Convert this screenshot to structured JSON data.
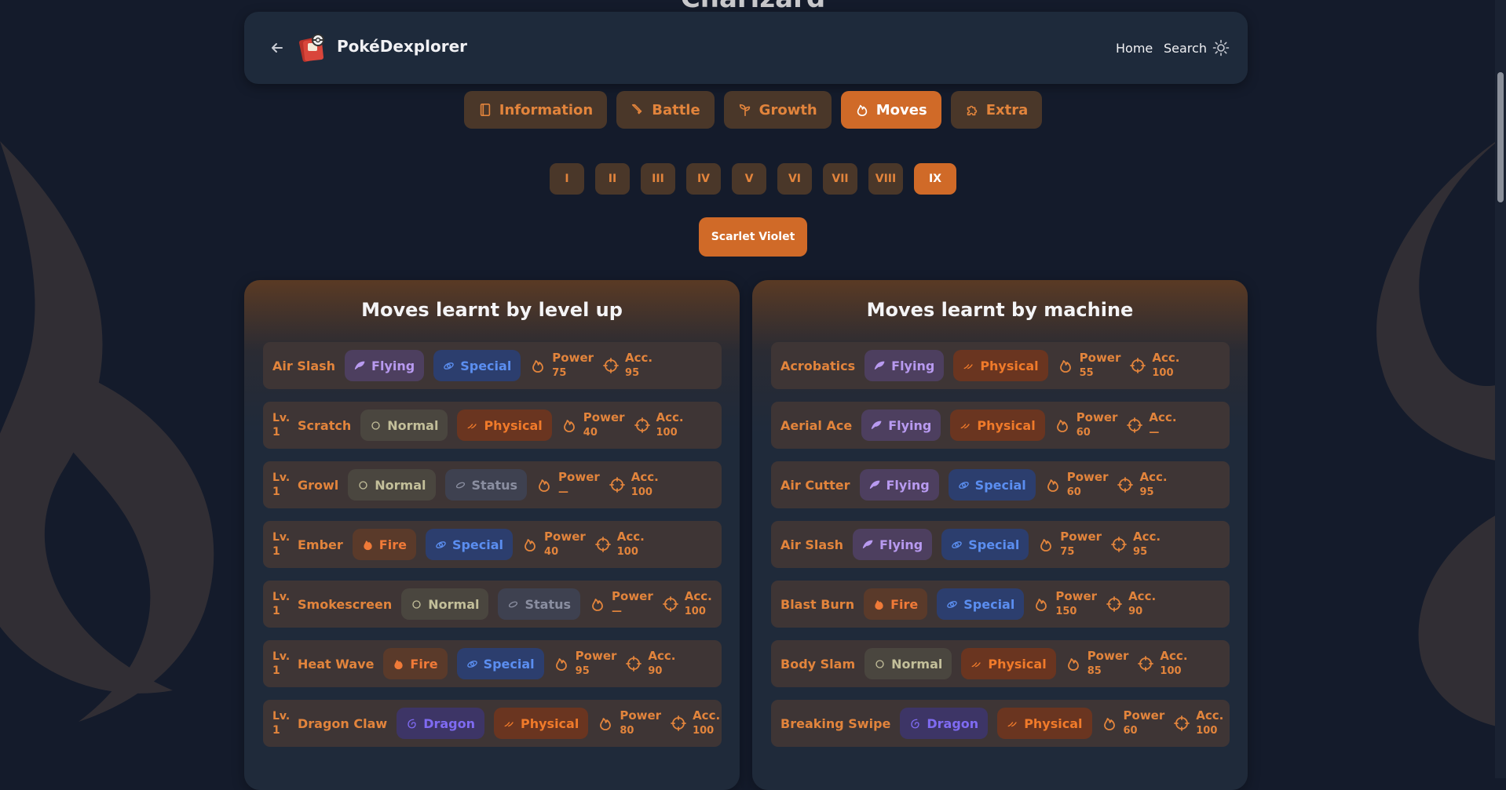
{
  "page": {
    "title_peek": "Charizard"
  },
  "header": {
    "brand": "PokéDexplorer",
    "nav": {
      "home": "Home",
      "search": "Search"
    },
    "icons": {
      "back": "arrow-left-icon",
      "logo": "pokedex-logo",
      "theme": "sun-icon"
    }
  },
  "tabs": [
    {
      "label": "Information",
      "icon": "book-icon",
      "active": false
    },
    {
      "label": "Battle",
      "icon": "sword-icon",
      "active": false
    },
    {
      "label": "Growth",
      "icon": "sprout-icon",
      "active": false
    },
    {
      "label": "Moves",
      "icon": "flame-icon",
      "active": true
    },
    {
      "label": "Extra",
      "icon": "puzzle-icon",
      "active": false
    }
  ],
  "generations": [
    {
      "label": "I",
      "active": false
    },
    {
      "label": "II",
      "active": false
    },
    {
      "label": "III",
      "active": false
    },
    {
      "label": "IV",
      "active": false
    },
    {
      "label": "V",
      "active": false
    },
    {
      "label": "VI",
      "active": false
    },
    {
      "label": "VII",
      "active": false
    },
    {
      "label": "VIII",
      "active": false
    },
    {
      "label": "IX",
      "active": true
    }
  ],
  "version": {
    "label": "Scarlet Violet"
  },
  "labels": {
    "lv": "Lv.",
    "power": "Power",
    "acc": "Acc."
  },
  "colors": {
    "accent": "#d06a28",
    "types": {
      "Flying": {
        "bg": "#4d3f5f",
        "fg": "#b89af0"
      },
      "Normal": {
        "bg": "#4a463f",
        "fg": "#c3bf9a"
      },
      "Fire": {
        "bg": "#5a3a2a",
        "fg": "#f07a38"
      },
      "Dragon": {
        "bg": "#3d3566",
        "fg": "#7f6bf2"
      },
      "Fighting": {
        "bg": "#5a2e2e",
        "fg": "#e05a4a"
      }
    },
    "categories": {
      "Special": {
        "bg": "#2c3e6e",
        "fg": "#5b8ef0"
      },
      "Physical": {
        "bg": "#6a3520",
        "fg": "#f07a2a"
      },
      "Status": {
        "bg": "#3e4150",
        "fg": "#8a8ea0"
      }
    }
  },
  "level_up": {
    "title": "Moves learnt by level up",
    "moves": [
      {
        "level": "",
        "name": "Air Slash",
        "type": "Flying",
        "category": "Special",
        "power": "75",
        "acc": "95"
      },
      {
        "level": "1",
        "name": "Scratch",
        "type": "Normal",
        "category": "Physical",
        "power": "40",
        "acc": "100"
      },
      {
        "level": "1",
        "name": "Growl",
        "type": "Normal",
        "category": "Status",
        "power": "—",
        "acc": "100"
      },
      {
        "level": "1",
        "name": "Ember",
        "type": "Fire",
        "category": "Special",
        "power": "40",
        "acc": "100"
      },
      {
        "level": "1",
        "name": "Smokescreen",
        "type": "Normal",
        "category": "Status",
        "power": "—",
        "acc": "100"
      },
      {
        "level": "1",
        "name": "Heat Wave",
        "type": "Fire",
        "category": "Special",
        "power": "95",
        "acc": "90"
      },
      {
        "level": "1",
        "name": "Dragon Claw",
        "type": "Dragon",
        "category": "Physical",
        "power": "80",
        "acc": "100"
      }
    ]
  },
  "machine": {
    "title": "Moves learnt by machine",
    "moves": [
      {
        "name": "Acrobatics",
        "type": "Flying",
        "category": "Physical",
        "power": "55",
        "acc": "100"
      },
      {
        "name": "Aerial Ace",
        "type": "Flying",
        "category": "Physical",
        "power": "60",
        "acc": "—"
      },
      {
        "name": "Air Cutter",
        "type": "Flying",
        "category": "Special",
        "power": "60",
        "acc": "95"
      },
      {
        "name": "Air Slash",
        "type": "Flying",
        "category": "Special",
        "power": "75",
        "acc": "95"
      },
      {
        "name": "Blast Burn",
        "type": "Fire",
        "category": "Special",
        "power": "150",
        "acc": "90"
      },
      {
        "name": "Body Slam",
        "type": "Normal",
        "category": "Physical",
        "power": "85",
        "acc": "100"
      },
      {
        "name": "Breaking Swipe",
        "type": "Dragon",
        "category": "Physical",
        "power": "60",
        "acc": "100"
      }
    ]
  }
}
